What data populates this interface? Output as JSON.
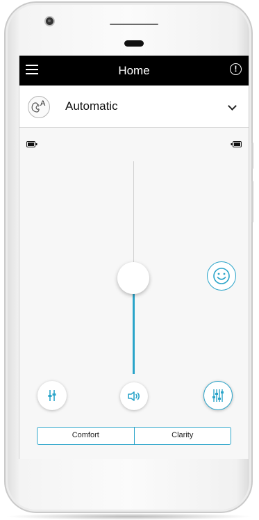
{
  "header": {
    "title": "Home",
    "menu_icon": "hamburger-menu-icon",
    "alert_icon": "exclamation-circle-icon",
    "alert_glyph": "!"
  },
  "program": {
    "label": "Automatic",
    "icon": "automatic-program-icon",
    "icon_letter": "A",
    "dropdown_icon": "chevron-down-icon"
  },
  "batteries": {
    "left_icon": "battery-icon",
    "right_icon": "battery-icon"
  },
  "volume_slider": {
    "level": 0.45
  },
  "controls": {
    "smiley_icon": "smiley-face-icon",
    "left_icon": "equalizer-icon",
    "center_icon": "speaker-volume-icon",
    "right_icon": "equalizer-sliders-icon"
  },
  "modes": {
    "comfort_label": "Comfort",
    "clarity_label": "Clarity"
  },
  "colors": {
    "accent": "#2aa4c9",
    "header_bg": "#000000"
  }
}
